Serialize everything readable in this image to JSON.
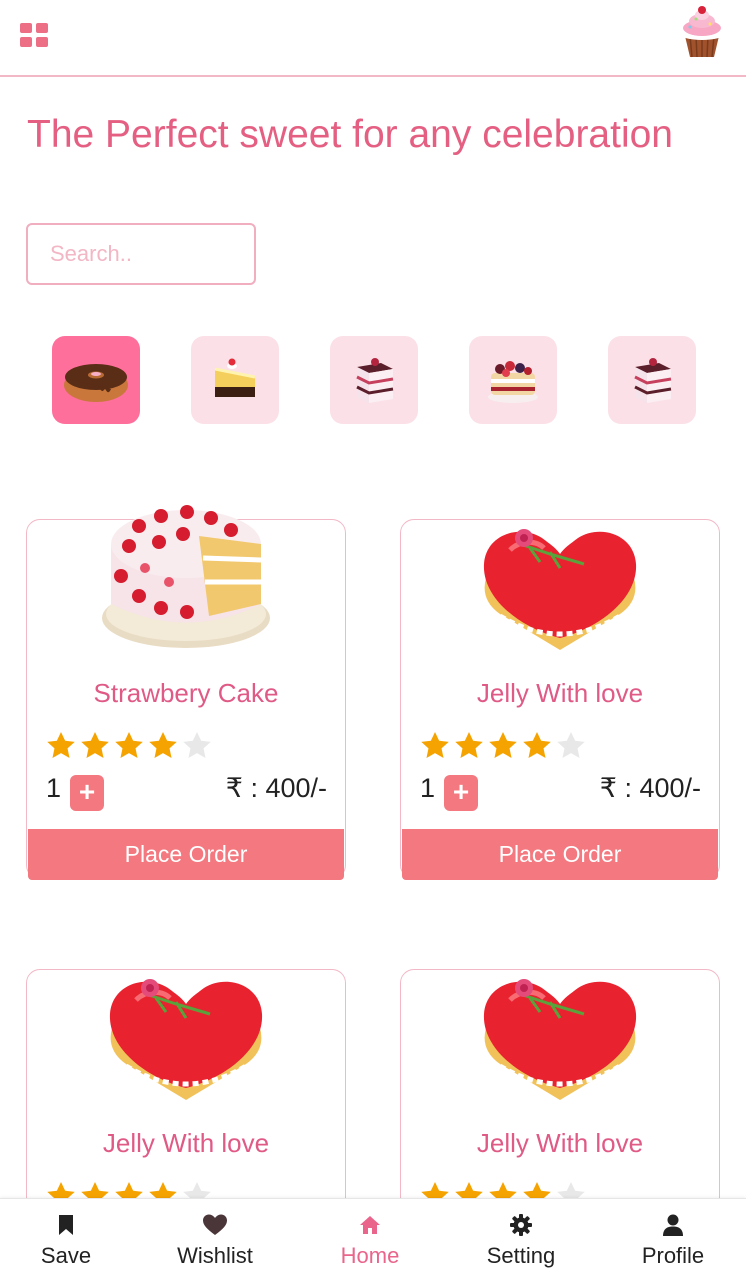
{
  "header": {
    "menu_icon": "grid-menu-icon",
    "logo": "cupcake-logo",
    "headline": "The Perfect sweet for any celebration"
  },
  "search": {
    "placeholder": "Search..",
    "value": ""
  },
  "categories": [
    {
      "icon": "bundt-cake-icon",
      "active": true
    },
    {
      "icon": "cheesecake-slice-icon",
      "active": false
    },
    {
      "icon": "pastry-slice-icon",
      "active": false
    },
    {
      "icon": "berry-layer-cake-icon",
      "active": false
    },
    {
      "icon": "pastry-slice-icon",
      "active": false
    }
  ],
  "products": [
    {
      "name": "Strawbery Cake",
      "rating": 4,
      "max_rating": 5,
      "quantity": "1",
      "price": "₹ : 400/-",
      "button": "Place Order",
      "image": "strawberry-cake"
    },
    {
      "name": "Jelly With love",
      "rating": 4,
      "max_rating": 5,
      "quantity": "1",
      "price": "₹ : 400/-",
      "button": "Place Order",
      "image": "heart-jelly-cake"
    },
    {
      "name": "Jelly With love",
      "rating": 4,
      "max_rating": 5,
      "image": "heart-jelly-cake"
    },
    {
      "name": "Jelly With love",
      "rating": 4,
      "max_rating": 5,
      "image": "heart-jelly-cake"
    }
  ],
  "nav": {
    "items": [
      {
        "label": "Save",
        "icon": "bookmark-icon",
        "active": false
      },
      {
        "label": "Wishlist",
        "icon": "heart-icon",
        "active": false
      },
      {
        "label": "Home",
        "icon": "home-icon",
        "active": true
      },
      {
        "label": "Setting",
        "icon": "gear-icon",
        "active": false
      },
      {
        "label": "Profile",
        "icon": "user-icon",
        "active": false
      }
    ]
  },
  "colors": {
    "brand": "#e45f82",
    "accent": "#f3787f",
    "active_tab": "#e9658c",
    "star": "#f5a300",
    "star_empty": "#e8e8e8"
  }
}
